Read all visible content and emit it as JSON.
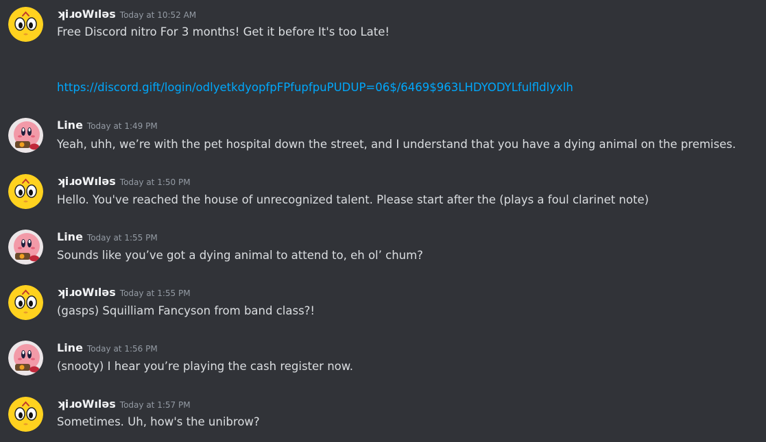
{
  "messages": [
    {
      "author": "ʞiɹoWıləs",
      "avatar": "yellow-face-icon",
      "timestamp": "Today at 10:52 AM",
      "text": "Free Discord nitro For 3 months! Get it before It's too Late!",
      "link": "https://discord.gift/login/odlyetkdyopfpFPfupfpuPUDUP=06$/6469$963LHDYODYLfulfldlyxlh"
    },
    {
      "author": "Line",
      "avatar": "kirby-icon",
      "timestamp": "Today at 1:49 PM",
      "text": "Yeah, uhh, we’re with the pet hospital down the street, and I understand that you have a dying animal on the premises."
    },
    {
      "author": "ʞiɹoWıləs",
      "avatar": "yellow-face-icon",
      "timestamp": "Today at 1:50 PM",
      "text": "Hello. You've reached the house of unrecognized talent. Please start after the (plays a foul clarinet note)"
    },
    {
      "author": "Line",
      "avatar": "kirby-icon",
      "timestamp": "Today at 1:55 PM",
      "text": "Sounds like you’ve got a dying animal to attend to, eh ol’ chum?"
    },
    {
      "author": "ʞiɹoWıləs",
      "avatar": "yellow-face-icon",
      "timestamp": "Today at 1:55 PM",
      "text": "(gasps) Squilliam Fancyson from band class?!"
    },
    {
      "author": "Line",
      "avatar": "kirby-icon",
      "timestamp": "Today at 1:56 PM",
      "text": "(snooty) I hear you’re playing the cash register now."
    },
    {
      "author": "ʞiɹoWıləs",
      "avatar": "yellow-face-icon",
      "timestamp": "Today at 1:57 PM",
      "text": "Sometimes. Uh, how's the unibrow?"
    }
  ],
  "colors": {
    "background": "#313338",
    "username": "#f2f3f5",
    "timestamp": "#949ba4",
    "text": "#dbdee1",
    "link": "#00a8fc",
    "yellow_avatar": "#ffd21f",
    "kirby_avatar": "#f29aa8"
  }
}
